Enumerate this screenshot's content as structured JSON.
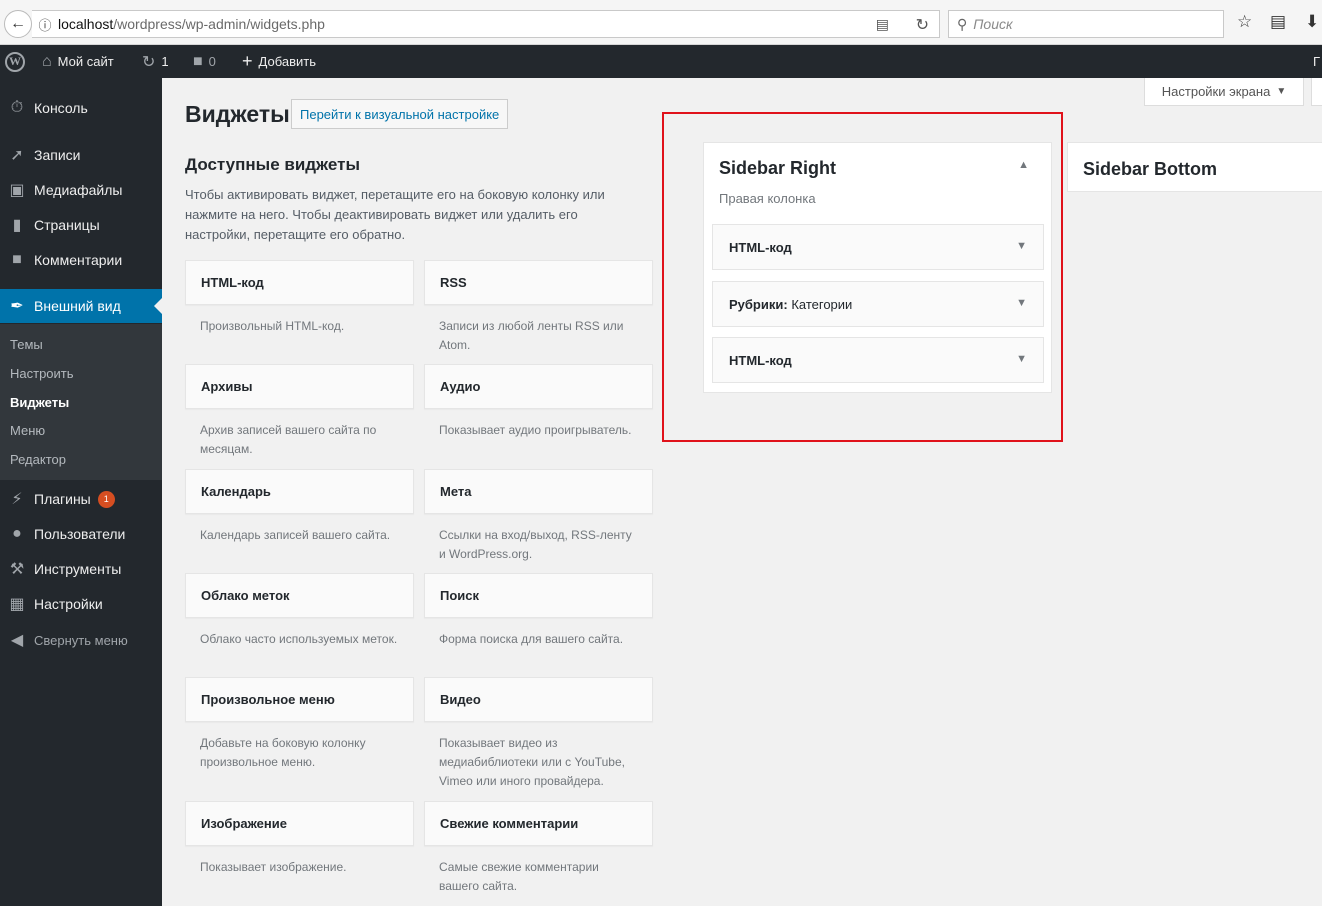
{
  "browser": {
    "url_host": "localhost",
    "url_path": "/wordpress/wp-admin/widgets.php",
    "search_placeholder": "Поиск"
  },
  "adminbar": {
    "site_name": "Мой сайт",
    "updates_count": "1",
    "comments_count": "0",
    "add_new": "Добавить",
    "right_partial": "Г"
  },
  "sidebar": {
    "items": [
      {
        "label": "Консоль",
        "icon": "dashboard-icon"
      },
      {
        "label": "Записи",
        "icon": "pin-icon"
      },
      {
        "label": "Медиафайлы",
        "icon": "media-icon"
      },
      {
        "label": "Страницы",
        "icon": "page-icon"
      },
      {
        "label": "Комментарии",
        "icon": "comment-icon"
      },
      {
        "label": "Внешний вид",
        "icon": "brush-icon"
      },
      {
        "label": "Плагины",
        "icon": "plugin-icon",
        "badge": "1"
      },
      {
        "label": "Пользователи",
        "icon": "user-icon"
      },
      {
        "label": "Инструменты",
        "icon": "wrench-icon"
      },
      {
        "label": "Настройки",
        "icon": "settings-icon"
      },
      {
        "label": "Свернуть меню",
        "icon": "collapse-icon"
      }
    ],
    "submenu": [
      "Темы",
      "Настроить",
      "Виджеты",
      "Меню",
      "Редактор"
    ]
  },
  "screen_options": "Настройки экрана",
  "page": {
    "title": "Виджеты",
    "title_action": "Перейти к визуальной настройке",
    "available_title": "Доступные виджеты",
    "available_desc": "Чтобы активировать виджет, перетащите его на боковую колонку или нажмите на него. Чтобы деактивировать виджет или удалить его настройки, перетащите его обратно."
  },
  "widgets": [
    {
      "title": "HTML-код",
      "desc": "Произвольный HTML-код."
    },
    {
      "title": "RSS",
      "desc": "Записи из любой ленты RSS или Atom."
    },
    {
      "title": "Архивы",
      "desc": "Архив записей вашего сайта по месяцам."
    },
    {
      "title": "Аудио",
      "desc": "Показывает аудио проигрыватель."
    },
    {
      "title": "Календарь",
      "desc": "Календарь записей вашего сайта."
    },
    {
      "title": "Мета",
      "desc": "Ссылки на вход/выход, RSS-ленту и WordPress.org."
    },
    {
      "title": "Облако меток",
      "desc": "Облако часто используемых меток."
    },
    {
      "title": "Поиск",
      "desc": "Форма поиска для вашего сайта."
    },
    {
      "title": "Произвольное меню",
      "desc": "Добавьте на боковую колонку произвольное меню."
    },
    {
      "title": "Видео",
      "desc": "Показывает видео из медиабиблиотеки или с YouTube, Vimeo или иного провайдера."
    },
    {
      "title": "Изображение",
      "desc": "Показывает изображение."
    },
    {
      "title": "Свежие комментарии",
      "desc": "Самые свежие комментарии вашего сайта."
    }
  ],
  "sidebar_right": {
    "title": "Sidebar Right",
    "desc": "Правая колонка",
    "widgets": [
      {
        "name": "HTML-код",
        "subtitle": ""
      },
      {
        "name": "Рубрики:",
        "subtitle": " Категории"
      },
      {
        "name": "HTML-код",
        "subtitle": ""
      }
    ]
  },
  "sidebar_bottom": {
    "title": "Sidebar Bottom"
  },
  "colors": {
    "admin_dark": "#23282d",
    "accent_blue": "#0073aa",
    "highlight_red": "#e0121b",
    "badge_orange": "#d54e21"
  }
}
